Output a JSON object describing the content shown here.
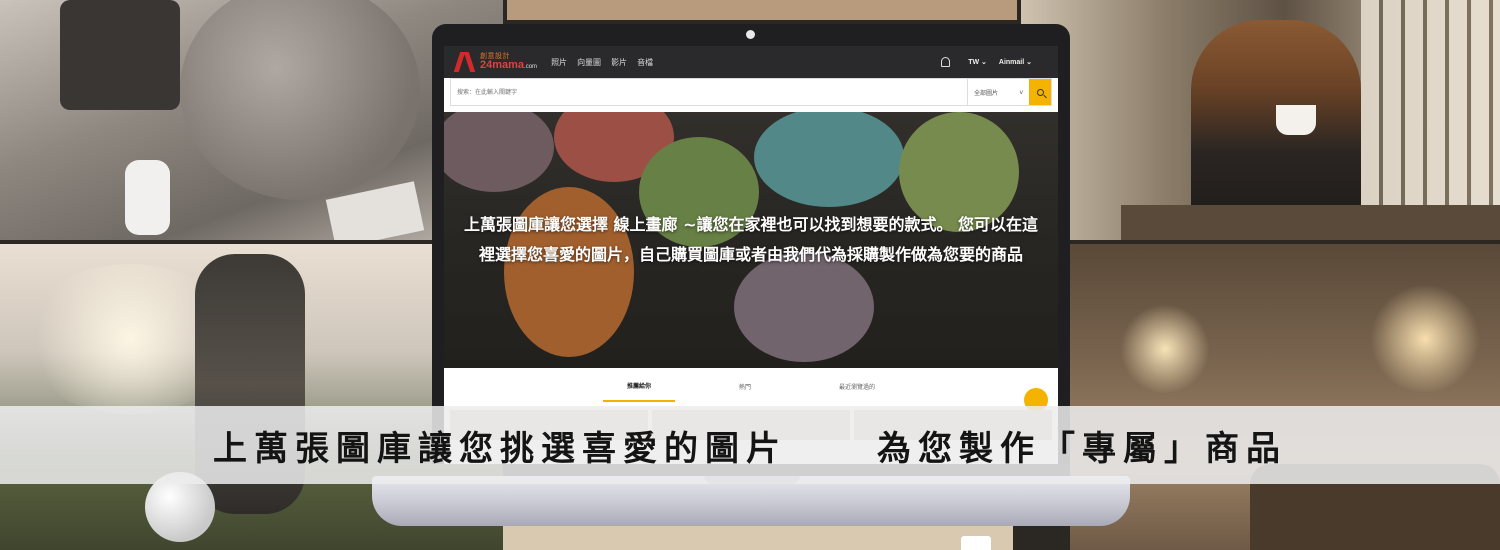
{
  "site": {
    "logo_top": "創意設計",
    "logo_main": "24mama",
    "logo_suffix": ".com",
    "nav": [
      "照片",
      "向量圖",
      "影片",
      "音檔"
    ],
    "region": "TW ⌄",
    "user": "Ainmail ⌄"
  },
  "search": {
    "placeholder": "搜索：在此輸入關鍵字",
    "category": "全部圖片",
    "chevron": "v"
  },
  "hero": {
    "line1": "上萬張圖庫讓您選擇 線上畫廊 ~讓您在家裡也可以找到想要的款式。 您可以在這",
    "line2": "裡選擇您喜愛的圖片，自己購買圖庫或者由我們代為採購製作做為您要的商品"
  },
  "tabs": [
    "推薦給你",
    "熱門",
    "最近瀏覽過的"
  ],
  "banner": {
    "left": "上萬張圖庫讓您挑選喜愛的圖片",
    "right": "為您製作「專屬」商品"
  },
  "colors": {
    "accent": "#f3b300",
    "brand_red": "#d22a2a",
    "nav_bg": "#2a2a2c"
  }
}
